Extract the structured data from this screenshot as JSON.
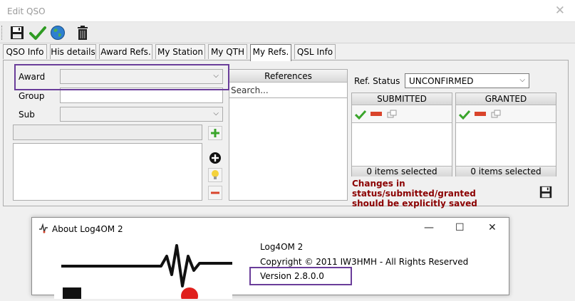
{
  "window": {
    "title": "Edit QSO",
    "close_glyph": "✕"
  },
  "toolbar": {
    "items": [
      "save-icon",
      "confirm-check-icon",
      "globe-icon",
      "trash-icon"
    ]
  },
  "tabs": [
    {
      "label": "QSO Info"
    },
    {
      "label": "His details"
    },
    {
      "label": "Award Refs."
    },
    {
      "label": "My Station"
    },
    {
      "label": "My QTH"
    },
    {
      "label": "My Refs.",
      "active": true
    },
    {
      "label": "QSL Info"
    }
  ],
  "form": {
    "award_label": "Award",
    "award_value": "",
    "group_label": "Group",
    "group_value": "",
    "sub_label": "Sub",
    "sub_value": "",
    "ref_input_value": ""
  },
  "references": {
    "header": "References",
    "search_placeholder": "Search..."
  },
  "ref_status": {
    "label": "Ref. Status",
    "value": "UNCONFIRMED"
  },
  "submitted": {
    "header": "SUBMITTED",
    "footer": "0 items selected"
  },
  "granted": {
    "header": "GRANTED",
    "footer": "0 items selected"
  },
  "warning": {
    "line1": "Changes in status/submitted/granted",
    "line2": "should be explicitly saved"
  },
  "about": {
    "title": "About Log4OM 2",
    "app_name": "Log4OM 2",
    "copyright": "Copyright © 2011 IW3HMH - All Rights Reserved",
    "version": "Version 2.8.0.0",
    "minimize": "—",
    "maximize": "☐",
    "close": "✕"
  },
  "colors": {
    "highlight": "#6a3d9a",
    "warning_text": "#8b0000",
    "check_green": "#3aa52b",
    "minus_red": "#d9442b"
  }
}
